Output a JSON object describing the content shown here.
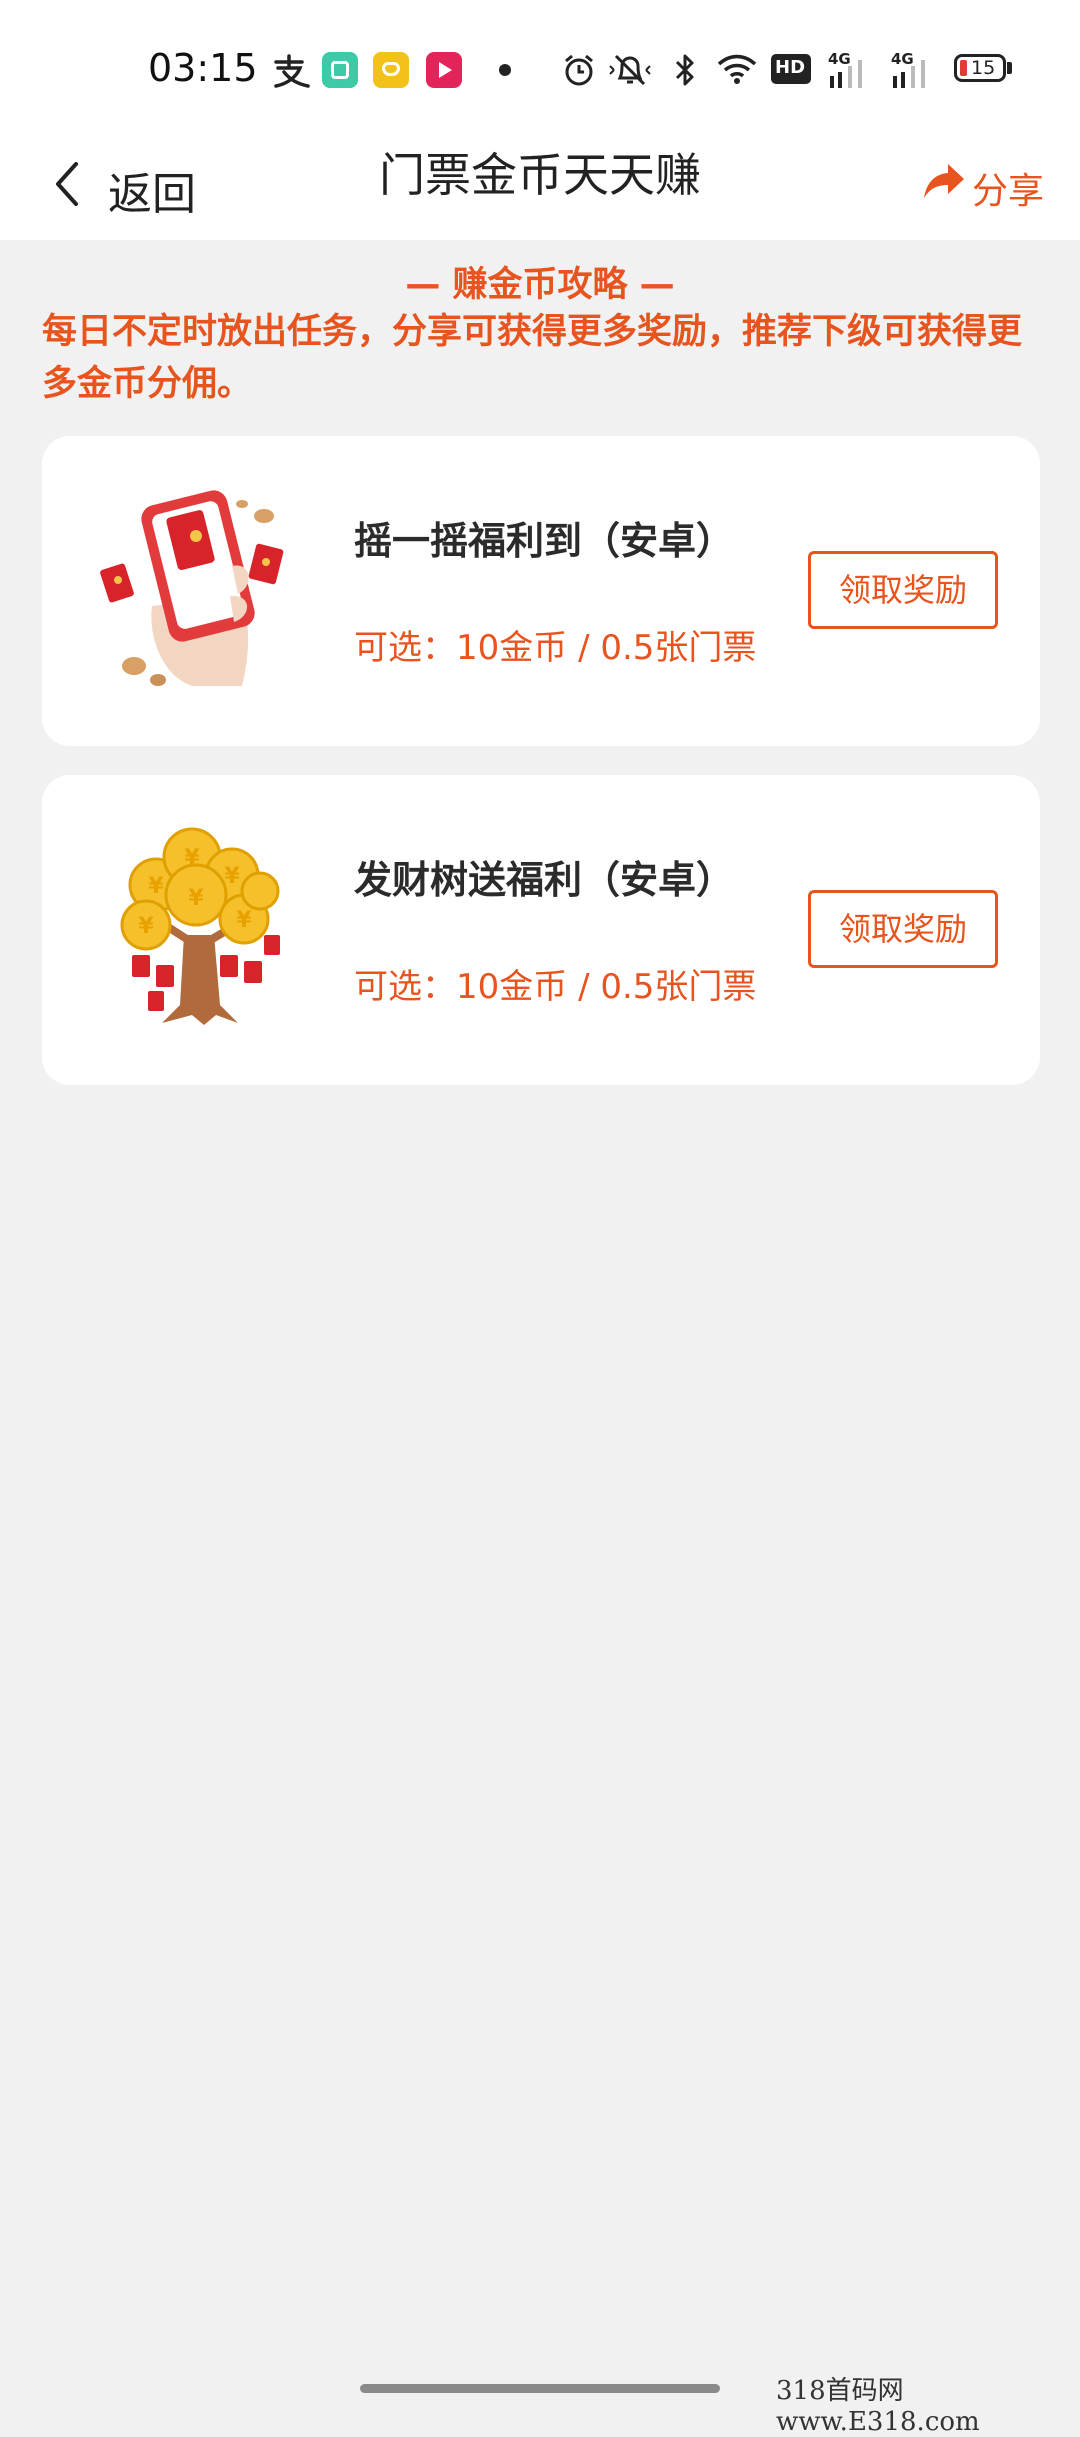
{
  "status_bar": {
    "time": "03:15",
    "battery_level": "15",
    "network_1": "4G",
    "network_2": "4G",
    "hd_label": "HD",
    "icons": [
      "alipay-icon",
      "app-green-icon",
      "app-yellow-icon",
      "app-red-play-icon",
      "dot-icon",
      "alarm-icon",
      "mute-icon",
      "bluetooth-icon",
      "wifi-icon",
      "hd-icon",
      "signal-icon",
      "signal-icon",
      "battery-icon"
    ]
  },
  "nav": {
    "back_label": "返回",
    "title": "门票金币天天赚",
    "share_label": "分享"
  },
  "tips": {
    "title": "— 赚金币攻略 —",
    "text": "每日不定时放出任务，分享可获得更多奖励，推荐下级可获得更多金币分佣。"
  },
  "tasks": [
    {
      "title": "摇一摇福利到（安卓）",
      "reward": "可选：10金币 / 0.5张门票",
      "button_label": "领取奖励",
      "image_icon": "shake-phone-icon"
    },
    {
      "title": "发财树送福利（安卓）",
      "reward": "可选：10金币 / 0.5张门票",
      "button_label": "领取奖励",
      "image_icon": "money-tree-icon"
    }
  ],
  "watermark": "318首码网 www.E318.com",
  "colors": {
    "accent": "#e8541e",
    "background": "#f1f1f1",
    "card": "#ffffff"
  }
}
